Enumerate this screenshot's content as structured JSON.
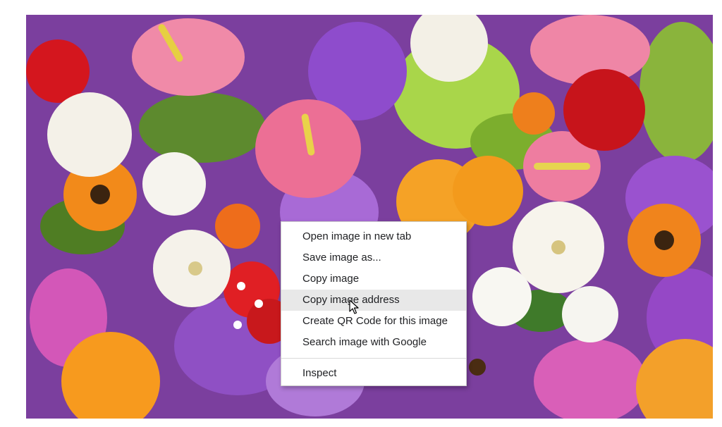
{
  "image": {
    "subject": "flowers-photo-icon"
  },
  "context_menu": {
    "items": [
      {
        "label": "Open image in new tab"
      },
      {
        "label": "Save image as..."
      },
      {
        "label": "Copy image"
      },
      {
        "label": "Copy image address"
      },
      {
        "label": "Create QR Code for this image"
      },
      {
        "label": "Search image with Google"
      }
    ],
    "inspect_label": "Inspect",
    "highlighted_index": 3
  },
  "colors": {
    "menu_background": "#ffffff",
    "menu_highlight": "#e8e8e8",
    "menu_text": "#202124",
    "menu_border": "#c9c9c9"
  },
  "cursor": {
    "icon": "arrow-pointer-icon"
  }
}
